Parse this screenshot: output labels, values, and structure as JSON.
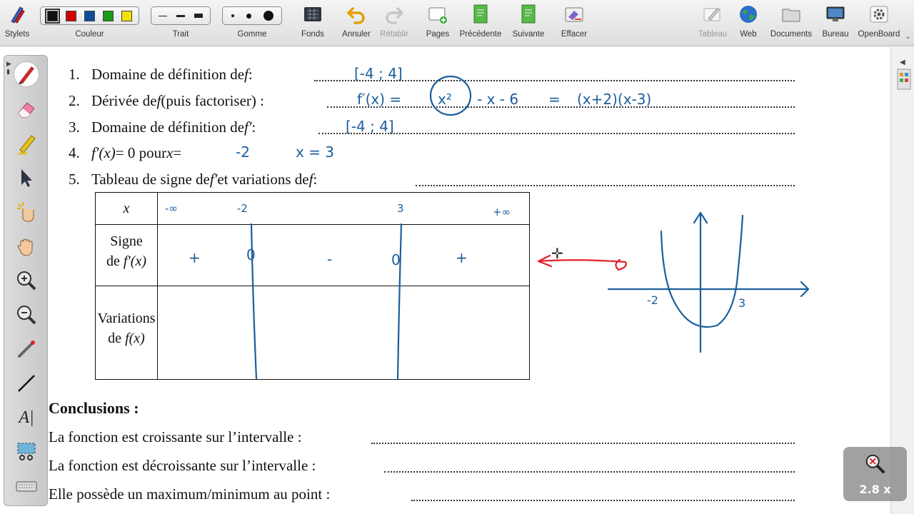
{
  "toolbar": {
    "stylets": "Stylets",
    "couleur": "Couleur",
    "trait": "Trait",
    "gomme": "Gomme",
    "fonds": "Fonds",
    "annuler": "Annuler",
    "retablir": "Rétablir",
    "pages": "Pages",
    "precedente": "Précédente",
    "suivante": "Suivante",
    "effacer": "Effacer",
    "tableau": "Tableau",
    "web": "Web",
    "documents": "Documents",
    "bureau": "Bureau",
    "openboard": "OpenBoard",
    "colors": [
      "#111111",
      "#d40000",
      "#0b4f9c",
      "#1b9a1b",
      "#f2e200"
    ]
  },
  "doc": {
    "q1_num": "1.",
    "q1_text": "Domaine de définition de ",
    "q1_var": "f",
    "q1_tail": " :",
    "q2_num": "2.",
    "q2_text": "Dérivée de ",
    "q2_var": "f",
    "q2_tail": " (puis factoriser) :",
    "q3_num": "3.",
    "q3_text": "Domaine de définition de ",
    "q3_var": "f′",
    "q3_tail": " :",
    "q4_num": "4.",
    "q4_expr": "f′(x)",
    "q4_text": " = 0 pour ",
    "q4_var": "x",
    "q4_eq": " = ",
    "q5_num": "5.",
    "q5_text": "Tableau de signe de ",
    "q5_var1": "f′",
    "q5_mid": " et variations de ",
    "q5_var2": "f",
    "q5_tail": " :",
    "table": {
      "x_label": "x",
      "sign_label_1": "Signe",
      "sign_label_2": "de ",
      "sign_label_var": "f′(x)",
      "var_label_1": "Variations",
      "var_label_2": "de ",
      "var_label_var": "f(x)"
    },
    "conclusions_title": "Conclusions :",
    "c1": "La fonction est croissante sur l’intervalle :",
    "c2": "La fonction est décroissante sur l’intervalle :",
    "c3": "Elle possède un maximum/minimum au point :"
  },
  "ink": {
    "domain_f": "[-4 ; 4]",
    "derivative_lhs": "f′(x) =",
    "derivative_x2": "x²",
    "derivative_rest": "- x - 6",
    "derivative_eq": "=",
    "factored": "(x+2)(x-3)",
    "domain_fprime": "[-4 ; 4]",
    "root1": "-2",
    "root2": "x = 3",
    "tbl_minus_inf": "-∞",
    "tbl_m2": "-2",
    "tbl_3": "3",
    "tbl_plus_inf": "+∞",
    "sign1": "+",
    "zero1": "0",
    "sign2": "-",
    "zero2": "0",
    "sign3": "+",
    "graph_m2": "-2",
    "graph_3": "3"
  },
  "zoom": {
    "value": "2.8 x"
  }
}
